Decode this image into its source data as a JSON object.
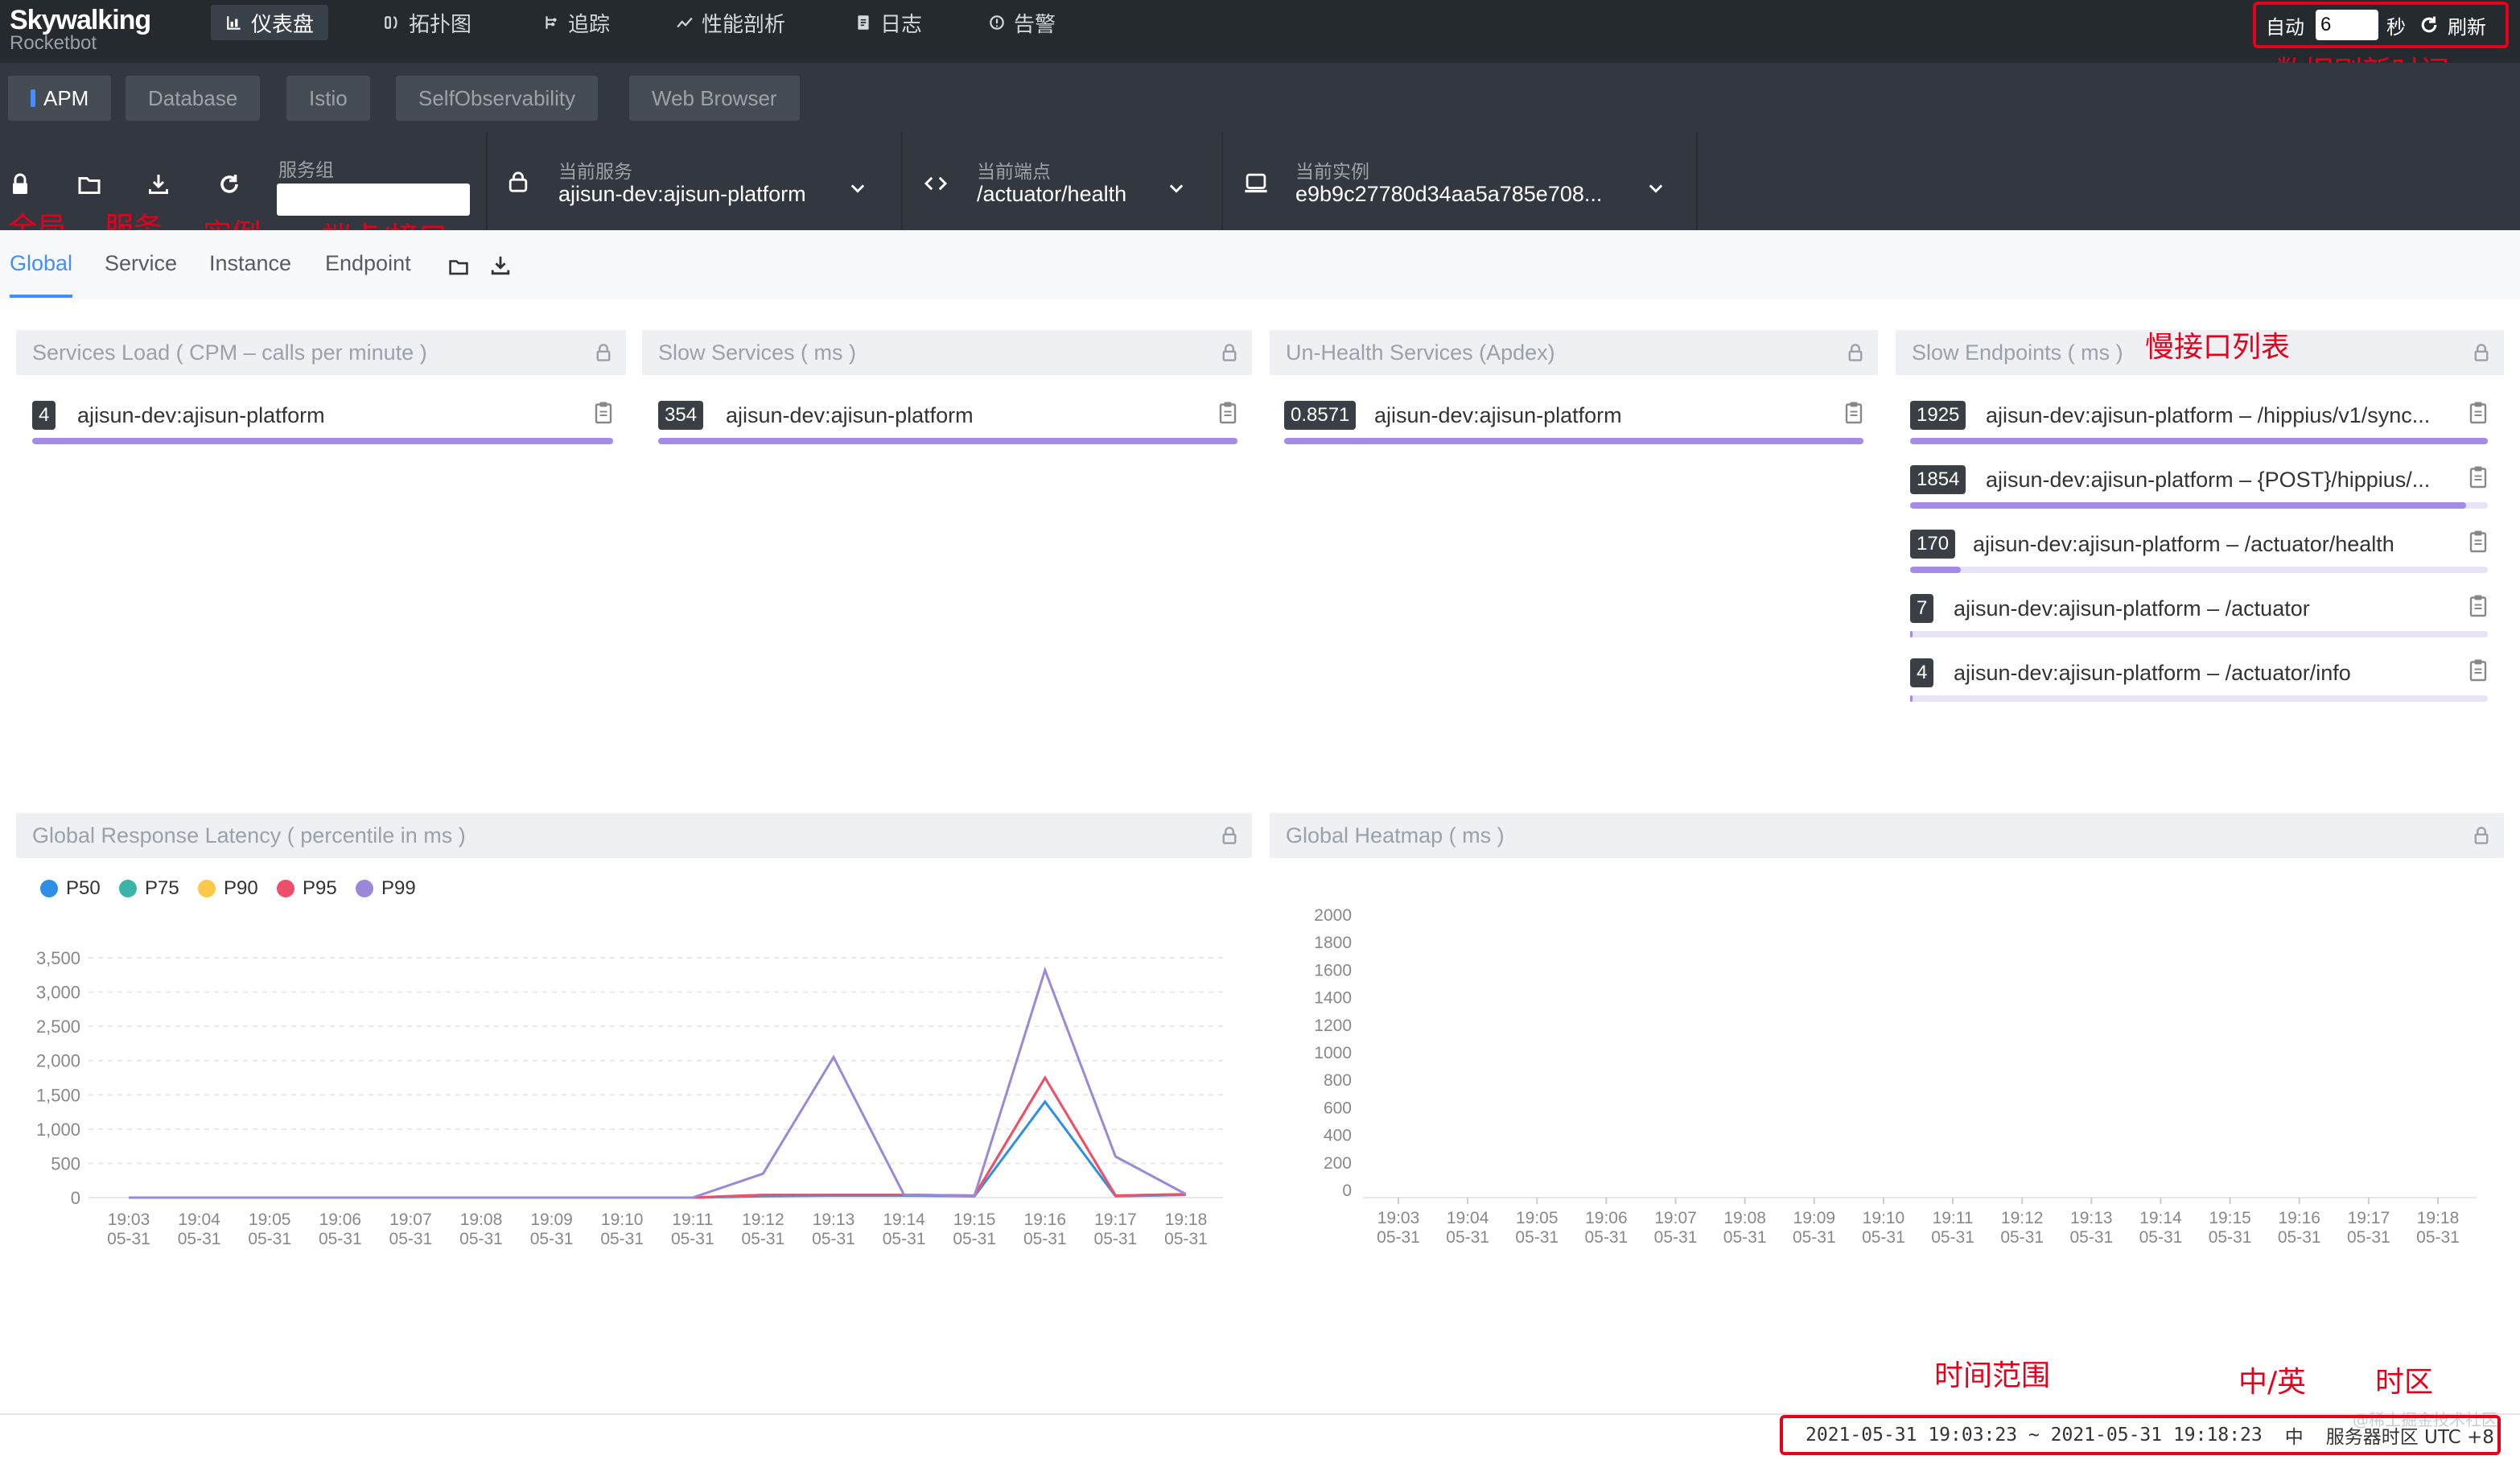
{
  "logo": {
    "name": "Skywalking",
    "sub": "Rocketbot"
  },
  "nav": [
    {
      "label": "仪表盘",
      "icon": "dashboard-icon",
      "active": true
    },
    {
      "label": "拓扑图",
      "icon": "topology-icon"
    },
    {
      "label": "追踪",
      "icon": "trace-icon"
    },
    {
      "label": "性能剖析",
      "icon": "profile-icon"
    },
    {
      "label": "日志",
      "icon": "log-icon"
    },
    {
      "label": "告警",
      "icon": "alarm-icon"
    }
  ],
  "refresh": {
    "auto_label": "自动",
    "interval": "6",
    "unit": "秒",
    "refresh_label": "刷新"
  },
  "layers": [
    "APM",
    "Database",
    "Istio",
    "SelfObservability",
    "Web Browser"
  ],
  "selectors": {
    "group_label": "服务组",
    "service_label": "当前服务",
    "service_value": "ajisun-dev:ajisun-platform",
    "endpoint_label": "当前端点",
    "endpoint_value": "/actuator/health",
    "instance_label": "当前实例",
    "instance_value": "e9b9c27780d34aa5a785e708..."
  },
  "tabs": [
    "Global",
    "Service",
    "Instance",
    "Endpoint"
  ],
  "annotations": {
    "global": "全局",
    "service": "服务",
    "instance": "实例",
    "endpoint": "端点/接口",
    "refresh_time": "数据刷新时间",
    "slow_list": "慢接口列表",
    "time_range": "时间范围",
    "lang": "中/英",
    "timezone": "时区"
  },
  "widgets": {
    "services_load": {
      "title": "Services Load ( CPM – calls per minute )",
      "rows": [
        {
          "value": "4",
          "label": "ajisun-dev:ajisun-platform",
          "ratio": 1.0
        }
      ]
    },
    "slow_services": {
      "title": "Slow Services ( ms )",
      "rows": [
        {
          "value": "354",
          "label": "ajisun-dev:ajisun-platform",
          "ratio": 1.0
        }
      ]
    },
    "unhealth_services": {
      "title": "Un-Health Services (Apdex)",
      "rows": [
        {
          "value": "0.8571",
          "label": "ajisun-dev:ajisun-platform",
          "ratio": 1.0
        }
      ]
    },
    "slow_endpoints": {
      "title": "Slow Endpoints ( ms )",
      "rows": [
        {
          "value": "1925",
          "label": "ajisun-dev:ajisun-platform – /hippius/v1/sync...",
          "ratio": 1.0
        },
        {
          "value": "1854",
          "label": "ajisun-dev:ajisun-platform – {POST}/hippius/...",
          "ratio": 0.963
        },
        {
          "value": "170",
          "label": "ajisun-dev:ajisun-platform – /actuator/health",
          "ratio": 0.088
        },
        {
          "value": "7",
          "label": "ajisun-dev:ajisun-platform – /actuator",
          "ratio": 0.004
        },
        {
          "value": "4",
          "label": "ajisun-dev:ajisun-platform – /actuator/info",
          "ratio": 0.002
        }
      ]
    },
    "latency": {
      "title": "Global Response Latency ( percentile in ms )"
    },
    "heatmap": {
      "title": "Global Heatmap ( ms )"
    }
  },
  "chart_data": [
    {
      "type": "line",
      "title": "Global Response Latency ( percentile in ms )",
      "categories": [
        "19:03\n05-31",
        "19:04\n05-31",
        "19:05\n05-31",
        "19:06\n05-31",
        "19:07\n05-31",
        "19:08\n05-31",
        "19:09\n05-31",
        "19:10\n05-31",
        "19:11\n05-31",
        "19:12\n05-31",
        "19:13\n05-31",
        "19:14\n05-31",
        "19:15\n05-31",
        "19:16\n05-31",
        "19:17\n05-31",
        "19:18\n05-31"
      ],
      "y_ticks": [
        "0",
        "500",
        "1,000",
        "1,500",
        "2,000",
        "2,500",
        "3,000",
        "3,500"
      ],
      "ylim": [
        0,
        3500
      ],
      "series": [
        {
          "name": "P50",
          "color": "#2f8ee6",
          "values": [
            0,
            0,
            0,
            0,
            0,
            0,
            0,
            0,
            0,
            20,
            30,
            30,
            20,
            1400,
            20,
            40
          ]
        },
        {
          "name": "P75",
          "color": "#3cb3a8",
          "values": [
            0,
            0,
            0,
            0,
            0,
            0,
            0,
            0,
            0,
            40,
            40,
            40,
            30,
            1750,
            30,
            50
          ]
        },
        {
          "name": "P90",
          "color": "#fbc94a",
          "values": [
            0,
            0,
            0,
            0,
            0,
            0,
            0,
            0,
            0,
            40,
            40,
            40,
            30,
            1750,
            30,
            50
          ]
        },
        {
          "name": "P95",
          "color": "#ef4f6b",
          "values": [
            0,
            0,
            0,
            0,
            0,
            0,
            0,
            0,
            0,
            40,
            40,
            40,
            30,
            1750,
            30,
            50
          ]
        },
        {
          "name": "P99",
          "color": "#9b88d8",
          "values": [
            0,
            0,
            0,
            0,
            0,
            0,
            0,
            0,
            0,
            350,
            2050,
            40,
            30,
            3320,
            600,
            50
          ]
        }
      ]
    },
    {
      "type": "heatmap",
      "title": "Global Heatmap ( ms )",
      "categories": [
        "19:03\n05-31",
        "19:04\n05-31",
        "19:05\n05-31",
        "19:06\n05-31",
        "19:07\n05-31",
        "19:08\n05-31",
        "19:09\n05-31",
        "19:10\n05-31",
        "19:11\n05-31",
        "19:12\n05-31",
        "19:13\n05-31",
        "19:14\n05-31",
        "19:15\n05-31",
        "19:16\n05-31",
        "19:17\n05-31",
        "19:18\n05-31"
      ],
      "y_ticks": [
        "0",
        "200",
        "400",
        "600",
        "800",
        "1000",
        "1200",
        "1400",
        "1600",
        "1800",
        "2000"
      ],
      "ylim": [
        0,
        2000
      ]
    }
  ],
  "footer": {
    "range": "2021-05-31 19:03:23 ~ 2021-05-31 19:18:23",
    "lang": "中",
    "tz": "服务器时区 UTC +8",
    "watermark": "@稀土掘金技术社区"
  }
}
